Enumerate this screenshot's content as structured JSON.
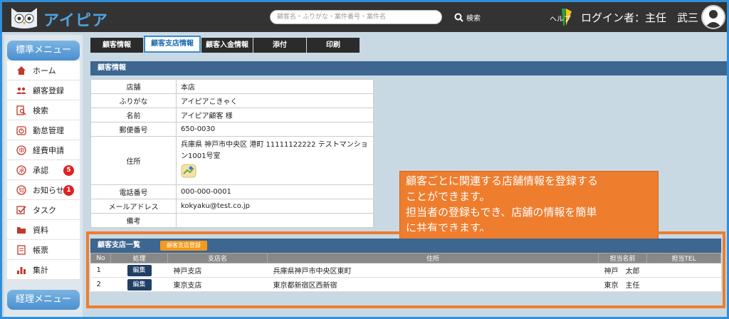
{
  "app": {
    "title": "アイピア"
  },
  "header": {
    "search_placeholder": "顧客名・ふりがな・案件番号・案件名",
    "search_label": "検索",
    "help_label": "ヘルプ",
    "login_text": "ログイン者：主任　武三"
  },
  "sidebar": {
    "standard_menu": "標準メニュー",
    "items": [
      {
        "label": "ホーム",
        "icon": "home-icon"
      },
      {
        "label": "顧客登録",
        "icon": "users-icon"
      },
      {
        "label": "検索",
        "icon": "search-doc-icon"
      },
      {
        "label": "勤怠管理",
        "icon": "clock-icon"
      },
      {
        "label": "経費申請",
        "icon": "expense-icon"
      },
      {
        "label": "承認",
        "icon": "approve-icon",
        "badge": "5"
      },
      {
        "label": "お知らせ",
        "icon": "notice-icon",
        "badge": "1"
      },
      {
        "label": "タスク",
        "icon": "check-icon"
      },
      {
        "label": "資料",
        "icon": "folder-icon"
      },
      {
        "label": "帳票",
        "icon": "document-icon"
      },
      {
        "label": "集計",
        "icon": "chart-icon"
      }
    ],
    "accounting_menu": "経理メニュー"
  },
  "tabs": [
    "顧客情報",
    "顧客支店情報",
    "顧客入金情報",
    "添付",
    "印刷"
  ],
  "customer_info": {
    "heading": "顧客情報",
    "rows": [
      {
        "label": "店舗",
        "value": "本店"
      },
      {
        "label": "ふりがな",
        "value": "アイピアこきゃく"
      },
      {
        "label": "名前",
        "value": "アイピア顧客 様"
      },
      {
        "label": "郵便番号",
        "value": "650-0030"
      },
      {
        "label": "住所",
        "value": "兵庫県 神戸市中央区 港町 11111122222 テストマンション1001号室"
      },
      {
        "label": "電話番号",
        "value": "000-000-0001"
      },
      {
        "label": "メールアドレス",
        "value": "kokyaku@test.co.jp"
      },
      {
        "label": "備考",
        "value": ""
      }
    ]
  },
  "callout": {
    "line1": "顧客ごとに関連する店舗情報を登録する",
    "line2": "ことができます。",
    "line3": "担当者の登録もでき、店舗の情報を簡単",
    "line4": "に共有できます。"
  },
  "branch": {
    "heading": "顧客支店一覧",
    "register_button": "顧客支店登録",
    "columns": [
      "No",
      "処理",
      "支店名",
      "住所",
      "担当名前",
      "担当TEL"
    ],
    "rows": [
      {
        "no": "1",
        "action": "編集",
        "name": "神戸支店",
        "address": "兵庫県神戸市中央区東町",
        "person": "神戸　太郎",
        "tel": ""
      },
      {
        "no": "2",
        "action": "編集",
        "name": "東京支店",
        "address": "東京都新宿区西新宿",
        "person": "東京　主任",
        "tel": ""
      }
    ]
  },
  "colors": {
    "header_bg": "#333333",
    "accent": "#2f8fd8",
    "section_head": "#3d6690",
    "callout": "#ee7d2e"
  }
}
